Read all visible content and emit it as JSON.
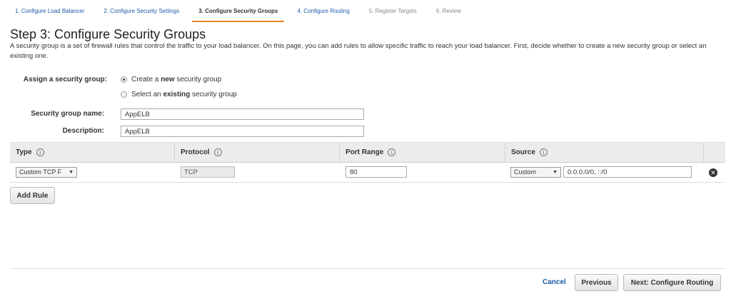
{
  "wizard_steps": [
    {
      "label": "1. Configure Load Balancer"
    },
    {
      "label": "2. Configure Security Settings"
    },
    {
      "label": "3. Configure Security Groups"
    },
    {
      "label": "4. Configure Routing"
    },
    {
      "label": "5. Register Targets"
    },
    {
      "label": "6. Review"
    }
  ],
  "page": {
    "title": "Step 3: Configure Security Groups",
    "description": "A security group is a set of firewall rules that control the traffic to your load balancer. On this page, you can add rules to allow specific traffic to reach your load balancer. First, decide whether to create a new security group or select an existing one."
  },
  "assign": {
    "label": "Assign a security group:",
    "option_new_prefix": "Create a ",
    "option_new_bold": "new",
    "option_new_suffix": " security group",
    "option_existing_prefix": "Select an ",
    "option_existing_bold": "existing",
    "option_existing_suffix": " security group",
    "selected": "new"
  },
  "form": {
    "name_label": "Security group name:",
    "name_value": "AppELB",
    "description_label": "Description:",
    "description_value": "AppELB"
  },
  "rules_table": {
    "headers": [
      "Type",
      "Protocol",
      "Port Range",
      "Source"
    ],
    "rows": [
      {
        "type": "Custom TCP F",
        "protocol": "TCP",
        "port_range": "80",
        "source_type": "Custom",
        "source_value": "0.0.0.0/0, ::/0"
      }
    ]
  },
  "add_rule_label": "Add Rule",
  "footer": {
    "cancel_label": "Cancel",
    "previous_label": "Previous",
    "next_label": "Next: Configure Routing"
  },
  "colors": {
    "accent_tab_underline": "#e7852b",
    "link": "#1a5ba8"
  }
}
